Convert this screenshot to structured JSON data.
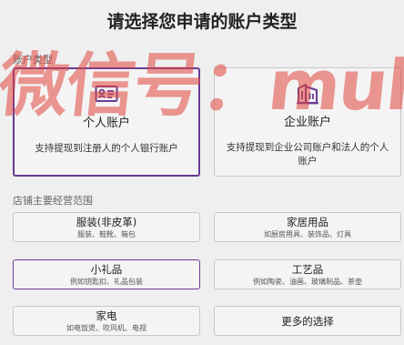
{
  "title": "请选择您申请的账户类型",
  "account_section_label": "账户类型",
  "account_cards": [
    {
      "title": "个人账户",
      "description": "支持提现到注册人的个人银行账户",
      "icon": "id-card-icon",
      "selected": true
    },
    {
      "title": "企业账户",
      "description": "支持提现到企业公司账户和法人的个人账户",
      "icon": "building-icon",
      "selected": false
    }
  ],
  "scope_section_label": "店铺主要经营范围",
  "scope_options": [
    {
      "title": "服装(非皮革)",
      "subtitle": "服装、鞋靴、箱包",
      "selected": false
    },
    {
      "title": "家居用品",
      "subtitle": "如厨房用具、装饰品、灯具",
      "selected": false
    },
    {
      "title": "小礼品",
      "subtitle": "例如钥匙扣、礼品包装",
      "selected": true
    },
    {
      "title": "工艺品",
      "subtitle": "例如陶瓷、油画、玻璃制品、茶壶",
      "selected": false
    },
    {
      "title": "家电",
      "subtitle": "如电饭煲、吹风机、电视",
      "selected": false
    },
    {
      "title": "更多的选择",
      "subtitle": "",
      "selected": false
    }
  ],
  "watermark_text": "微信号：muhuan_de",
  "colors": {
    "accent": "#6a3a94",
    "watermark": "#e0463c",
    "background": "#efefef"
  }
}
